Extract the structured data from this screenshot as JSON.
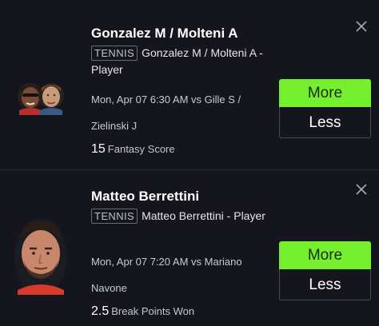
{
  "cards": [
    {
      "title": "Gonzalez M / Molteni A",
      "sport_tag": "TENNIS",
      "player_line": "Gonzalez M / Molteni A - Player",
      "match_line": "Mon, Apr 07 6:30 AM vs Gille S / Zielinski J",
      "stat_value": "15",
      "stat_label": "Fantasy Score",
      "more_label": "More",
      "less_label": "Less"
    },
    {
      "title": "Matteo Berrettini",
      "sport_tag": "TENNIS",
      "player_line": "Matteo Berrettini - Player",
      "match_line": "Mon, Apr 07 7:20 AM vs Mariano Navone",
      "stat_value": "2.5",
      "stat_label": "Break Points Won",
      "more_label": "More",
      "less_label": "Less"
    }
  ],
  "icons": {
    "close": "close-icon",
    "avatar": "player-avatar"
  },
  "colors": {
    "background": "#14151d",
    "more_button": "#76ef2e",
    "divider": "#2a2b36"
  }
}
